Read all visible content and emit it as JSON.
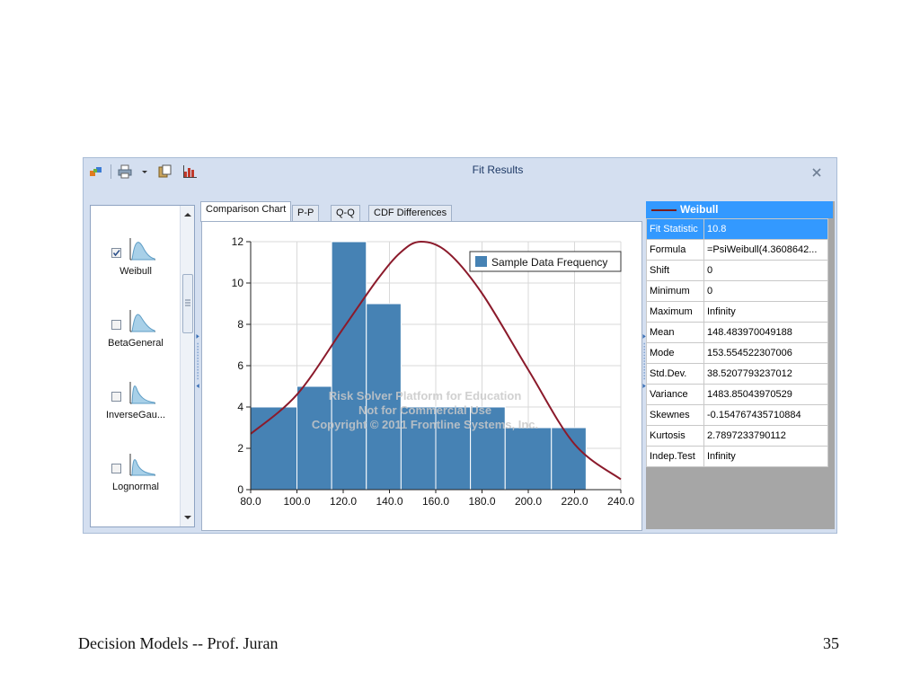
{
  "window": {
    "title": "Fit Results",
    "icons": [
      "fit-icon",
      "print-icon",
      "dropdown-arrow-icon",
      "copy-icon",
      "chart-icon"
    ],
    "close_icon": "close-icon"
  },
  "distributions": [
    {
      "label": "Weibull",
      "checked": true
    },
    {
      "label": "BetaGeneral",
      "checked": false
    },
    {
      "label": "InverseGau...",
      "checked": false
    },
    {
      "label": "Lognormal",
      "checked": false
    }
  ],
  "tabs": [
    {
      "label": "Comparison Chart",
      "active": true
    },
    {
      "label": "P-P",
      "active": false
    },
    {
      "label": "Q-Q",
      "active": false
    },
    {
      "label": "CDF Differences",
      "active": false
    }
  ],
  "chart_data": {
    "type": "bar",
    "legend": [
      "Sample Data Frequency"
    ],
    "legend_position": "top-right",
    "bin_edges": [
      80,
      100,
      115,
      130,
      145,
      160,
      175,
      190,
      210,
      225
    ],
    "values": [
      4,
      5,
      12,
      9,
      4,
      4,
      4,
      3,
      3
    ],
    "curve": {
      "type": "line",
      "x": [
        80,
        100,
        120,
        135,
        145,
        153.55,
        165,
        180,
        200,
        220,
        240
      ],
      "y": [
        2.7,
        4.6,
        7.8,
        10.2,
        11.5,
        12.0,
        11.5,
        9.5,
        5.8,
        2.2,
        0.5
      ]
    },
    "xlim": [
      80,
      240
    ],
    "ylim": [
      0,
      12
    ],
    "x_ticks": [
      "80.0",
      "100.0",
      "120.0",
      "140.0",
      "160.0",
      "180.0",
      "200.0",
      "220.0",
      "240.0"
    ],
    "y_ticks": [
      "0",
      "2",
      "4",
      "6",
      "8",
      "10",
      "12"
    ],
    "grid": true,
    "watermark": [
      "Risk Solver Platform for Education",
      "Not for Commercial Use",
      "Copyright © 2011 Frontline Systems, Inc."
    ],
    "colors": {
      "bars": "#4682b4",
      "curve": "#8b1a2b"
    }
  },
  "stats": {
    "header": "Weibull",
    "rows": [
      {
        "key": "Fit Statistic",
        "value": "10.8"
      },
      {
        "key": "Formula",
        "value": "=PsiWeibull(4.3608642..."
      },
      {
        "key": "Shift",
        "value": "0"
      },
      {
        "key": "Minimum",
        "value": "0"
      },
      {
        "key": "Maximum",
        "value": "Infinity"
      },
      {
        "key": "Mean",
        "value": "148.483970049188"
      },
      {
        "key": "Mode",
        "value": "153.554522307006"
      },
      {
        "key": "Std.Dev.",
        "value": "38.5207793237012"
      },
      {
        "key": "Variance",
        "value": "1483.85043970529"
      },
      {
        "key": "Skewnes",
        "value": "-0.154767435710884"
      },
      {
        "key": "Kurtosis",
        "value": "2.7897233790112"
      },
      {
        "key": "Indep.Test",
        "value": "Infinity"
      }
    ]
  },
  "footer": {
    "left": "Decision Models  --   Prof. Juran",
    "right": "35"
  }
}
